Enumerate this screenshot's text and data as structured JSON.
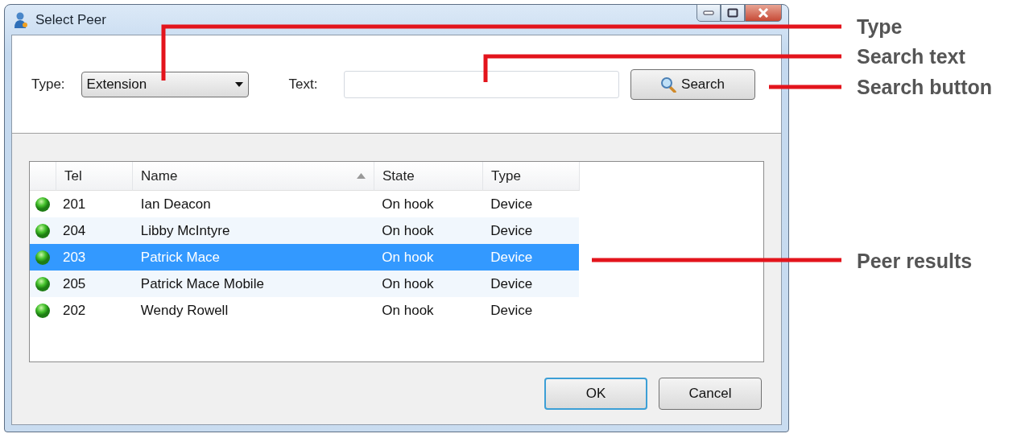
{
  "window": {
    "title": "Select Peer"
  },
  "search": {
    "type_label": "Type:",
    "type_value": "Extension",
    "text_label": "Text:",
    "button": "Search"
  },
  "table": {
    "columns": [
      {
        "label": "Tel",
        "sorted": false
      },
      {
        "label": "Name",
        "sorted": true
      },
      {
        "label": "State",
        "sorted": false
      },
      {
        "label": "Type",
        "sorted": false
      }
    ],
    "rows": [
      {
        "tel": "201",
        "name": "Ian Deacon",
        "state": "On hook",
        "type": "Device",
        "selected": false
      },
      {
        "tel": "204",
        "name": "Libby McIntyre",
        "state": "On hook",
        "type": "Device",
        "selected": false
      },
      {
        "tel": "203",
        "name": "Patrick Mace",
        "state": "On hook",
        "type": "Device",
        "selected": true
      },
      {
        "tel": "205",
        "name": "Patrick Mace Mobile",
        "state": "On hook",
        "type": "Device",
        "selected": false
      },
      {
        "tel": "202",
        "name": "Wendy Rowell",
        "state": "On hook",
        "type": "Device",
        "selected": false
      }
    ]
  },
  "buttons": [
    {
      "label": "OK",
      "default": true
    },
    {
      "label": "Cancel",
      "default": false
    }
  ],
  "annotations": [
    {
      "label": "Type"
    },
    {
      "label": "Search text"
    },
    {
      "label": "Search button"
    },
    {
      "label": "Peer results"
    }
  ]
}
